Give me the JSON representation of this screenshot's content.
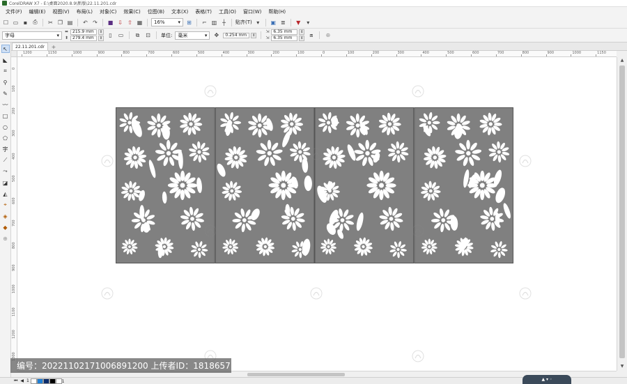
{
  "window": {
    "title": "CorelDRAW X7 - E:\\桌面2020.8.9\\新版\\22.11.201.cdr"
  },
  "menu": {
    "items": [
      "文件(F)",
      "编辑(E)",
      "视图(V)",
      "布局(L)",
      "对象(C)",
      "效果(C)",
      "位图(B)",
      "文本(X)",
      "表格(T)",
      "工具(O)",
      "窗口(W)",
      "帮助(H)"
    ]
  },
  "toolbar": {
    "zoom": "16%",
    "snap_label": "贴齐(T)"
  },
  "property_bar": {
    "paper_preset": "字母",
    "page_width": "215.9 mm",
    "page_height": "279.4 mm",
    "units_label": "单位:",
    "units_value": "毫米",
    "nudge": "0.254 mm",
    "dup_x": "6.35 mm",
    "dup_y": "6.35 mm"
  },
  "document": {
    "tab_name": "22.11.201.cdr"
  },
  "ruler": {
    "h_labels": [
      "1200",
      "1150",
      "1000",
      "900",
      "800",
      "700",
      "600",
      "500",
      "400",
      "300",
      "200",
      "100",
      "0",
      "100",
      "200",
      "300",
      "400",
      "500",
      "600",
      "700",
      "800",
      "900",
      "1000",
      "1150"
    ],
    "v_labels": [
      "0",
      "100",
      "200",
      "300",
      "400",
      "500",
      "600",
      "700",
      "800",
      "900",
      "1000",
      "1100",
      "1200",
      "1300"
    ]
  },
  "status": {
    "page_counter": "1 / 1",
    "page_tab": "页1"
  },
  "overlay": {
    "watermark_text": "编号：20221102171006891200 上传者ID：1818657"
  },
  "colors": {
    "panel_fill": "#808080",
    "panel_border": "#555555",
    "canvas": "#ffffff",
    "ui_bg": "#f0f0f0"
  }
}
